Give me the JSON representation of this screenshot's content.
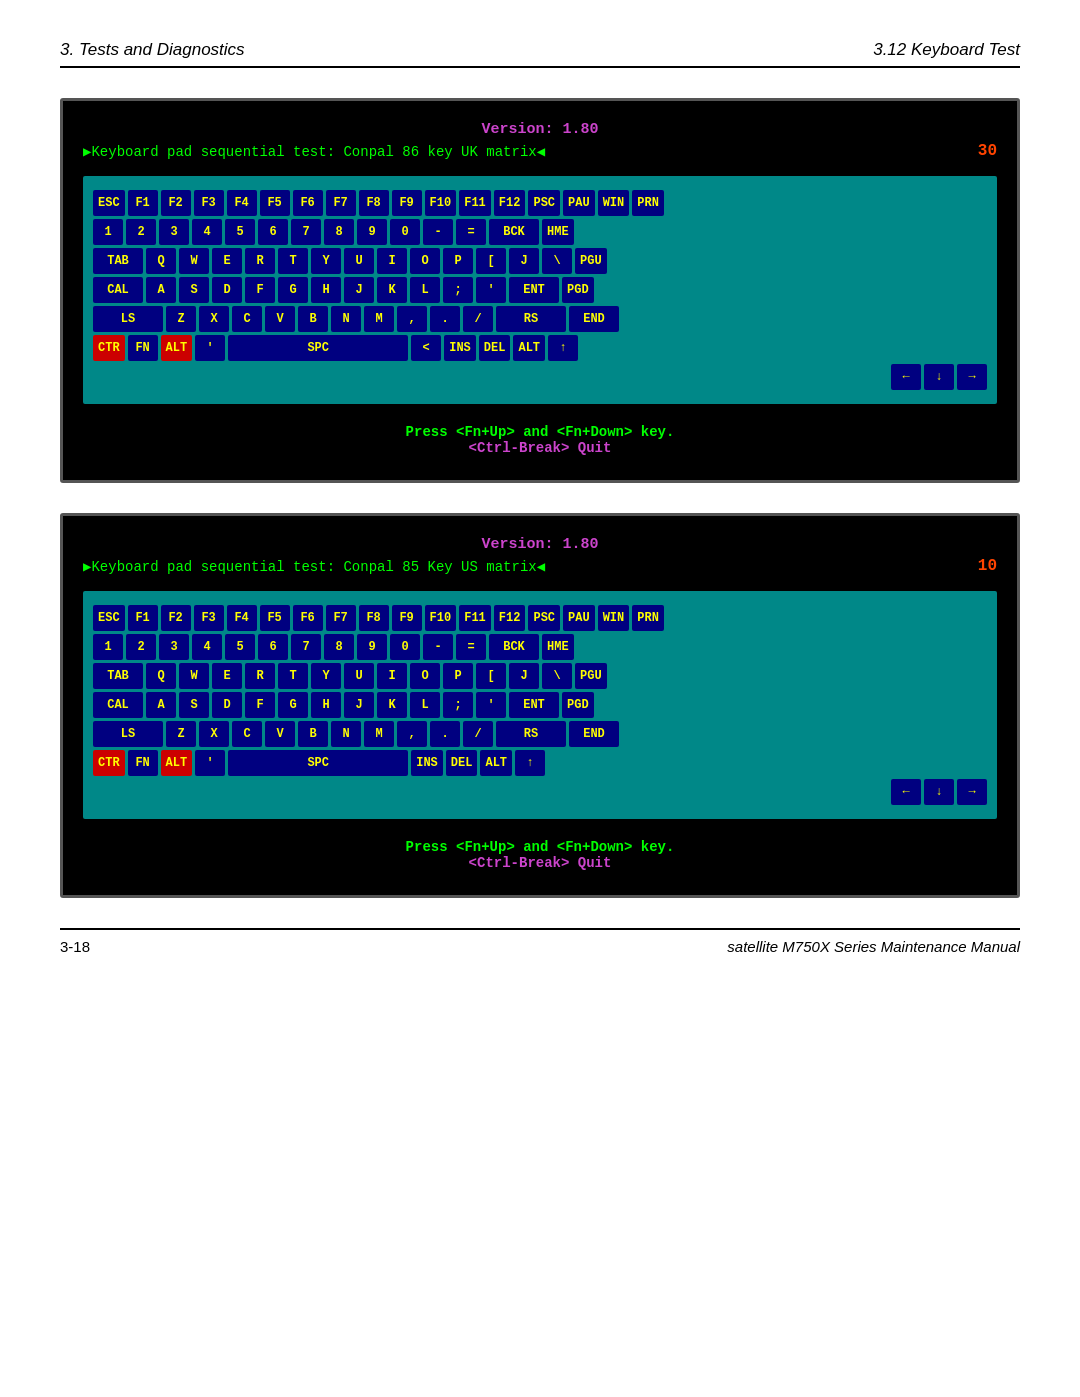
{
  "header": {
    "left": "3.  Tests and Diagnostics",
    "right": "3.12 Keyboard Test"
  },
  "screen1": {
    "version": "Version: 1.80",
    "test_desc": "▶Keyboard pad sequential test:  Conpal 86 key UK matrix◀",
    "counter": "30",
    "rows": [
      [
        "ESC",
        "F1",
        "F2",
        "F3",
        "F4",
        "F5",
        "F6",
        "F7",
        "F8",
        "F9",
        "F10",
        "F11",
        "F12",
        "PSC",
        "PAU",
        "WIN",
        "PRN"
      ],
      [
        "1",
        "2",
        "3",
        "4",
        "5",
        "6",
        "7",
        "8",
        "9",
        "0",
        "-",
        "=",
        "BCK",
        "HME"
      ],
      [
        "TAB",
        "Q",
        "W",
        "E",
        "R",
        "T",
        "Y",
        "U",
        "I",
        "O",
        "P",
        "[",
        "J",
        "\\",
        "PGU"
      ],
      [
        "CAL",
        "A",
        "S",
        "D",
        "F",
        "G",
        "H",
        "J",
        "K",
        "L",
        ";",
        "'",
        "ENT",
        "PGD"
      ],
      [
        "LS",
        "Z",
        "X",
        "C",
        "V",
        "B",
        "N",
        "M",
        ",",
        ".",
        "/",
        "RS",
        "END"
      ],
      [
        "CTR",
        "FN",
        "ALT",
        "'",
        "SPC",
        "<",
        "INS",
        "DEL",
        "ALT",
        "↑"
      ]
    ],
    "prompt1": "Press <Fn+Up> and <Fn+Down> key.",
    "prompt2": "<Ctrl-Break> Quit"
  },
  "screen2": {
    "version": "Version: 1.80",
    "test_desc": "▶Keyboard pad sequential test:  Conpal 85 Key US matrix◀",
    "counter": "10",
    "rows": [
      [
        "ESC",
        "F1",
        "F2",
        "F3",
        "F4",
        "F5",
        "F6",
        "F7",
        "F8",
        "F9",
        "F10",
        "F11",
        "F12",
        "PSC",
        "PAU",
        "WIN",
        "PRN"
      ],
      [
        "1",
        "2",
        "3",
        "4",
        "5",
        "6",
        "7",
        "8",
        "9",
        "0",
        "-",
        "=",
        "BCK",
        "HME"
      ],
      [
        "TAB",
        "Q",
        "W",
        "E",
        "R",
        "T",
        "Y",
        "U",
        "I",
        "O",
        "P",
        "[",
        "J",
        "\\",
        "PGU"
      ],
      [
        "CAL",
        "A",
        "S",
        "D",
        "F",
        "G",
        "H",
        "J",
        "K",
        "L",
        ";",
        "'",
        "ENT",
        "PGD"
      ],
      [
        "LS",
        "Z",
        "X",
        "C",
        "V",
        "B",
        "N",
        "M",
        ",",
        ".",
        "/",
        "RS",
        "END"
      ],
      [
        "CTR",
        "FN",
        "ALT",
        "'",
        "SPC",
        "INS",
        "DEL",
        "ALT",
        "↑"
      ]
    ],
    "prompt1": "Press <Fn+Up> and <Fn+Down> key.",
    "prompt2": "<Ctrl-Break> Quit"
  },
  "footer": {
    "left": "3-18",
    "right": "satellite M750X Series Maintenance Manual"
  }
}
